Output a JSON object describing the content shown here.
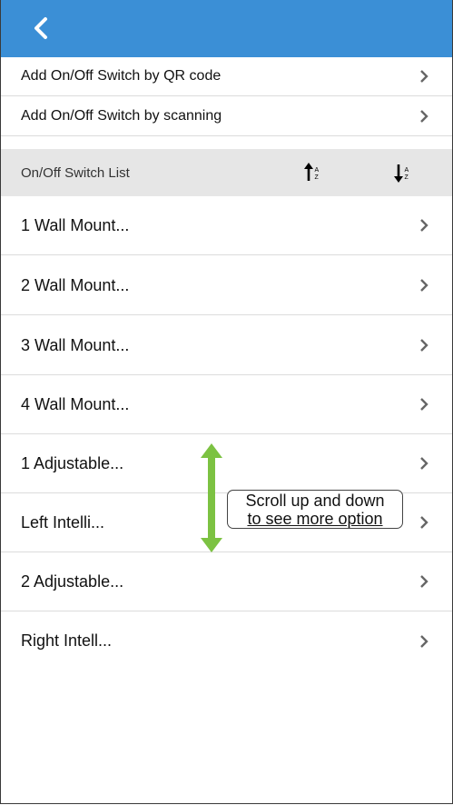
{
  "header": {
    "back_icon": "chevron-left-icon",
    "bar_color": "#3b8fd6"
  },
  "add_options": [
    {
      "label": "Add On/Off Switch by QR code"
    },
    {
      "label": "Add On/Off Switch by scanning"
    }
  ],
  "section": {
    "title": "On/Off Switch List",
    "sort_ascending_icon": "sort-ascending-icon",
    "sort_descending_icon": "sort-descending-icon"
  },
  "switches": [
    {
      "label": "1 Wall Mount..."
    },
    {
      "label": "2 Wall Mount..."
    },
    {
      "label": "3 Wall Mount..."
    },
    {
      "label": "4 Wall Mount..."
    },
    {
      "label": "1 Adjustable..."
    },
    {
      "label": "Left Intelli..."
    },
    {
      "label": "2 Adjustable..."
    },
    {
      "label": "Right Intell..."
    }
  ],
  "annotation": {
    "line1": "Scroll up and down",
    "line2": "to see more option",
    "arrow_color": "#7cc242"
  }
}
